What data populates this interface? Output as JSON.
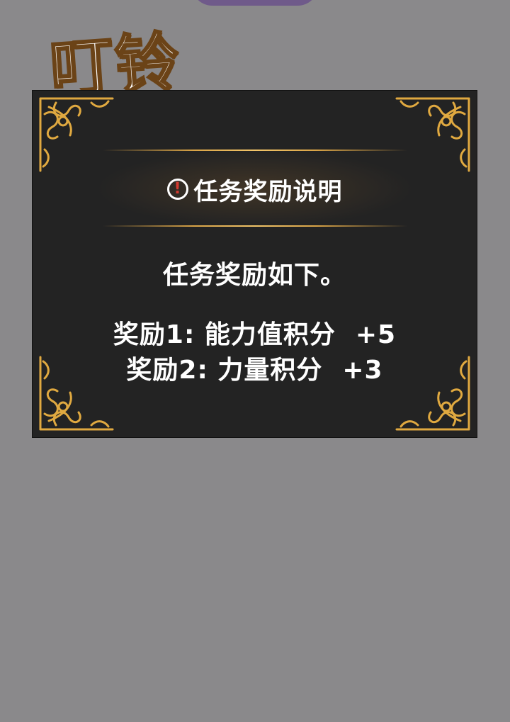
{
  "sound_effect": "叮铃",
  "panel": {
    "title": "任务奖励说明",
    "intro": "任务奖励如下。",
    "rewards": [
      {
        "label": "奖励1: 能力值积分",
        "value": "+5"
      },
      {
        "label": "奖励2: 力量积分",
        "value": "+3"
      }
    ]
  },
  "colors": {
    "background": "#8a898b",
    "panel": "#232323",
    "gold": "#e0a940",
    "alert_mark": "#d43a2f"
  },
  "icons": [
    "alert-icon",
    "ornament-corner-icon"
  ]
}
